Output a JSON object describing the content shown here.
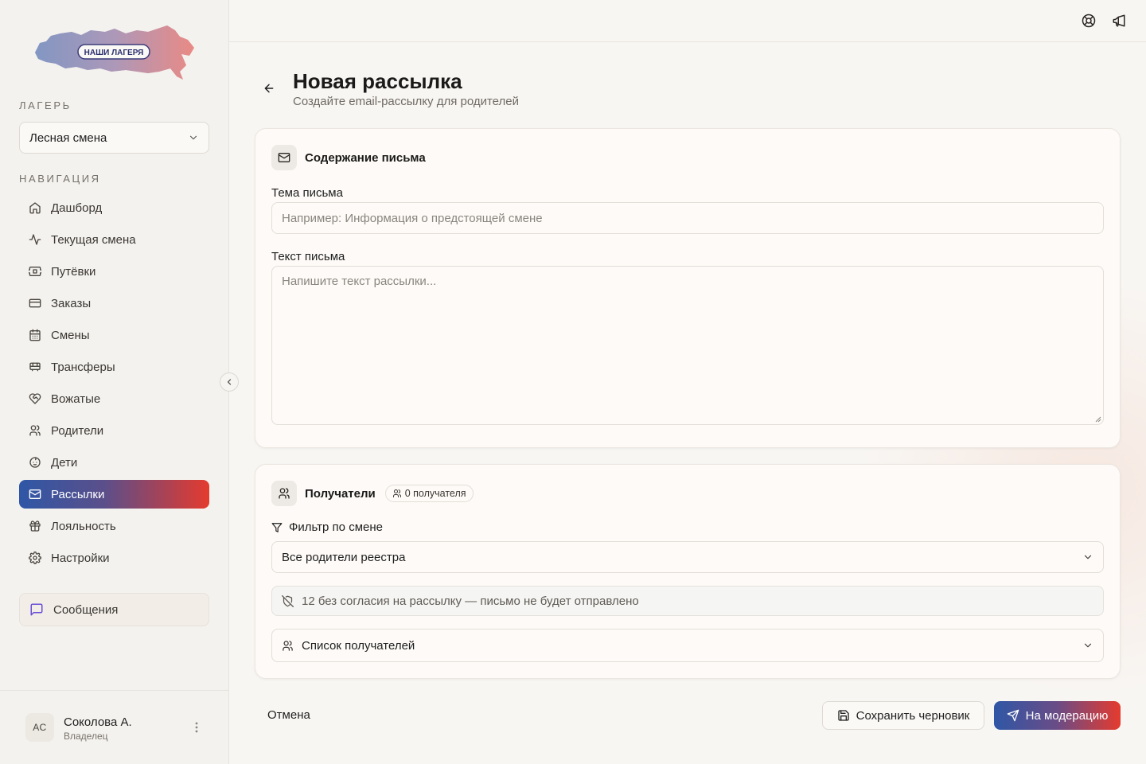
{
  "logo": {
    "text": "НАШИ ЛАГЕРЯ"
  },
  "sidebar": {
    "camp_label": "Лагерь",
    "camp_selected": "Лесная смена",
    "nav_label": "Навигация",
    "items": [
      {
        "label": "Дашборд",
        "icon": "home-icon"
      },
      {
        "label": "Текущая смена",
        "icon": "activity-icon"
      },
      {
        "label": "Путёвки",
        "icon": "ticket-icon"
      },
      {
        "label": "Заказы",
        "icon": "credit-card-icon"
      },
      {
        "label": "Смены",
        "icon": "calendar-icon"
      },
      {
        "label": "Трансферы",
        "icon": "bus-icon"
      },
      {
        "label": "Вожатые",
        "icon": "heart-handshake-icon"
      },
      {
        "label": "Родители",
        "icon": "users-icon"
      },
      {
        "label": "Дети",
        "icon": "baby-icon"
      },
      {
        "label": "Рассылки",
        "icon": "mail-icon",
        "active": true
      },
      {
        "label": "Лояльность",
        "icon": "gift-icon"
      },
      {
        "label": "Настройки",
        "icon": "gear-icon"
      }
    ],
    "messages_label": "Сообщения"
  },
  "user": {
    "initials": "АС",
    "name": "Соколова А.",
    "role": "Владелец"
  },
  "page": {
    "title": "Новая рассылка",
    "subtitle": "Создайте email-рассылку для родителей"
  },
  "content_card": {
    "title": "Содержание письма",
    "subject_label": "Тема письма",
    "subject_placeholder": "Например: Информация о предстоящей смене",
    "body_label": "Текст письма",
    "body_placeholder": "Напишите текст рассылки..."
  },
  "recipients_card": {
    "title": "Получатели",
    "count_badge": "0 получателя",
    "filter_label": "Фильтр по смене",
    "filter_value": "Все родители реестра",
    "notice": "12 без согласия на рассылку — письмо не будет отправлено",
    "list_label": "Список получателей"
  },
  "actions": {
    "cancel": "Отмена",
    "save_draft": "Сохранить черновик",
    "submit": "На модерацию"
  },
  "colors": {
    "accent_start": "#2f57a6",
    "accent_end": "#e53b2e",
    "background": "#f8f6f3"
  }
}
